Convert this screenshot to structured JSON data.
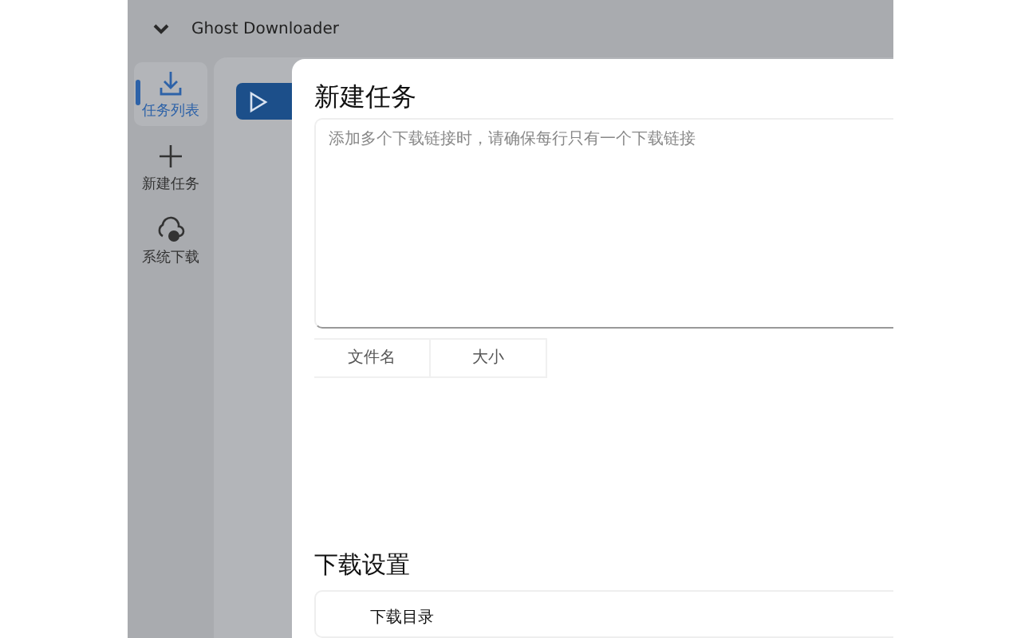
{
  "window": {
    "title": "Ghost Downloader"
  },
  "sidebar": {
    "items": [
      {
        "label": "任务列表",
        "selected": true
      },
      {
        "label": "新建任务",
        "selected": false
      },
      {
        "label": "系统下载",
        "selected": false
      }
    ]
  },
  "dialog": {
    "title": "新建任务",
    "links_field": {
      "placeholder": "添加多个下载链接时，请确保每行只有一个下载链接"
    },
    "table": {
      "columns": [
        "文件名",
        "大小"
      ]
    },
    "settings": {
      "title": "下载设置",
      "rows": [
        {
          "label": "下载目录"
        }
      ]
    }
  }
}
